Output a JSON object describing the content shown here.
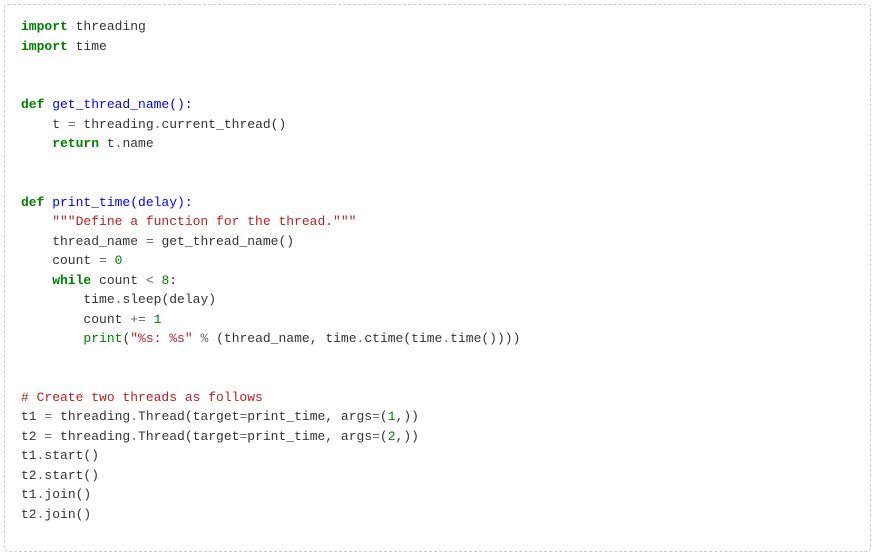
{
  "code": {
    "l1_kw1": "import",
    "l1_mod": " threading",
    "l2_kw1": "import",
    "l2_mod": " time",
    "l5_kw": "def",
    "l5_name": " get_thread_name():",
    "l6_a": "    t ",
    "l6_op": "=",
    "l6_b": " threading",
    "l6_op2": ".",
    "l6_c": "current_thread()",
    "l7_kw": "    return",
    "l7_b": " t",
    "l7_op": ".",
    "l7_c": "name",
    "l10_kw": "def",
    "l10_name": " print_time(delay):",
    "l11_str": "    \"\"\"Define a function for the thread.\"\"\"",
    "l12_a": "    thread_name ",
    "l12_op": "=",
    "l12_b": " get_thread_name()",
    "l13_a": "    count ",
    "l13_op": "=",
    "l13_sp": " ",
    "l13_num": "0",
    "l14_kw": "    while",
    "l14_a": " count ",
    "l14_op": "<",
    "l14_sp": " ",
    "l14_num": "8",
    "l14_c": ":",
    "l15_a": "        time",
    "l15_op": ".",
    "l15_b": "sleep(delay)",
    "l16_a": "        count ",
    "l16_op": "+=",
    "l16_sp": " ",
    "l16_num": "1",
    "l17_a": "        ",
    "l17_fn": "print",
    "l17_b": "(",
    "l17_str": "\"%s: %s\"",
    "l17_c": " ",
    "l17_op": "%",
    "l17_d": " (thread_name, time",
    "l17_op2": ".",
    "l17_e": "ctime(time",
    "l17_op3": ".",
    "l17_f": "time())))",
    "l20_comment": "# Create two threads as follows",
    "l21_a": "t1 ",
    "l21_op": "=",
    "l21_b": " threading",
    "l21_op2": ".",
    "l21_c": "Thread(target",
    "l21_op3": "=",
    "l21_d": "print_time, args",
    "l21_op4": "=",
    "l21_e": "(",
    "l21_num": "1",
    "l21_f": ",))",
    "l22_a": "t2 ",
    "l22_op": "=",
    "l22_b": " threading",
    "l22_op2": ".",
    "l22_c": "Thread(target",
    "l22_op3": "=",
    "l22_d": "print_time, args",
    "l22_op4": "=",
    "l22_e": "(",
    "l22_num": "2",
    "l22_f": ",))",
    "l23_a": "t1",
    "l23_op": ".",
    "l23_b": "start()",
    "l24_a": "t2",
    "l24_op": ".",
    "l24_b": "start()",
    "l25_a": "t1",
    "l25_op": ".",
    "l25_b": "join()",
    "l26_a": "t2",
    "l26_op": ".",
    "l26_b": "join()"
  }
}
